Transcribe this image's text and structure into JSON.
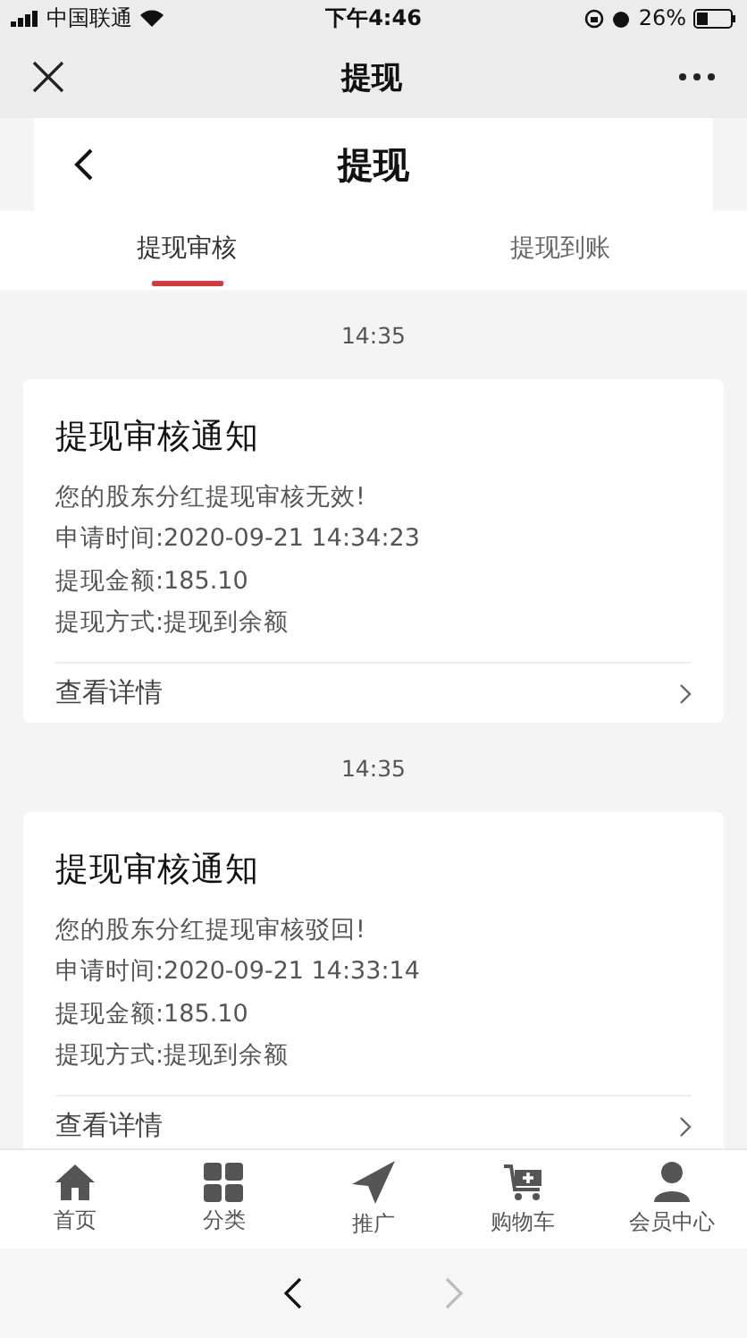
{
  "status_bar": {
    "carrier": "中国联通",
    "time": "下午4:46",
    "battery": "26%"
  },
  "wechat_bar": {
    "title": "提现"
  },
  "header": {
    "title": "提现"
  },
  "tabs": [
    {
      "label": "提现审核",
      "selected": true
    },
    {
      "label": "提现到账",
      "selected": false
    }
  ],
  "messages": [
    {
      "time": "14:35",
      "title": "提现审核通知",
      "lines": [
        "您的股东分红提现审核无效!",
        "申请时间:2020-09-21 14:34:23",
        "提现金额:185.10",
        "提现方式:提现到余额"
      ],
      "link": "查看详情"
    },
    {
      "time": "14:35",
      "title": "提现审核通知",
      "lines": [
        "您的股东分红提现审核驳回!",
        "申请时间:2020-09-21 14:33:14",
        "提现金额:185.10",
        "提现方式:提现到余额"
      ],
      "link": "查看详情"
    }
  ],
  "tab_bar": [
    {
      "kind": "home",
      "label": "首页"
    },
    {
      "kind": "grid",
      "label": "分类"
    },
    {
      "kind": "plane",
      "label": "推广"
    },
    {
      "kind": "cart",
      "label": "购物车"
    },
    {
      "kind": "user",
      "label": "会员中心"
    }
  ],
  "browser_nav": {
    "back_disabled": false,
    "forward_disabled": true
  }
}
